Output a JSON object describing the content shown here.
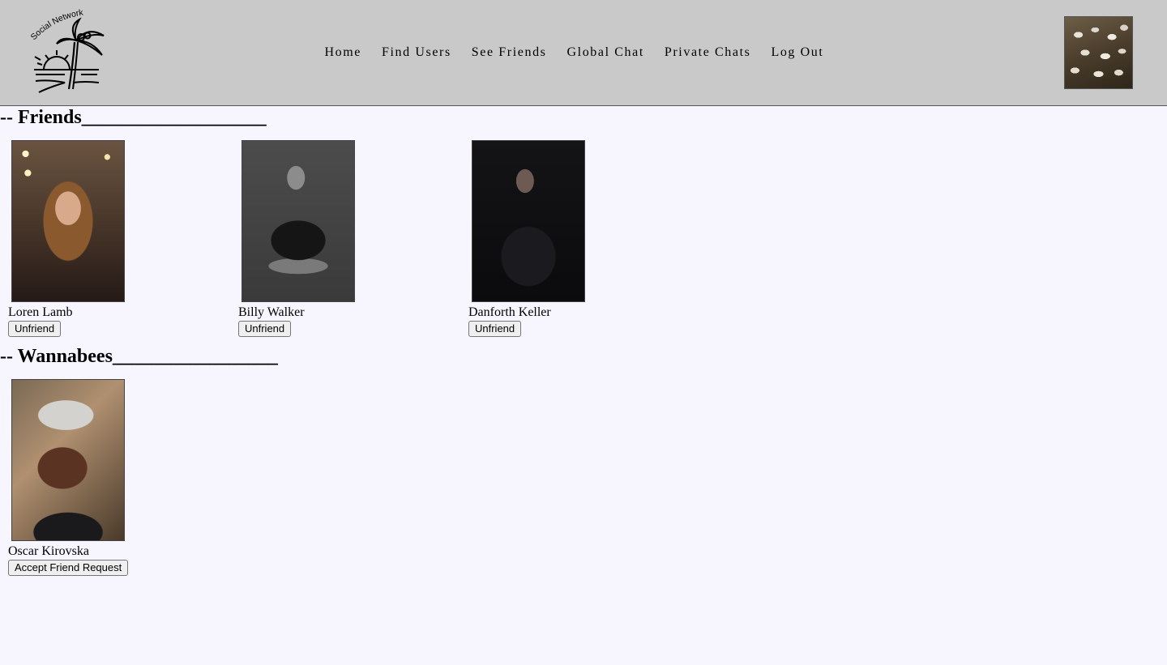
{
  "header": {
    "logo_text": "Social Network",
    "nav": [
      {
        "label": "Home"
      },
      {
        "label": "Find Users"
      },
      {
        "label": "See Friends"
      },
      {
        "label": "Global Chat"
      },
      {
        "label": "Private Chats"
      },
      {
        "label": "Log Out"
      }
    ],
    "avatar_icon": "user-avatar-mushrooms"
  },
  "friends_section": {
    "title": "-- Friends___________________",
    "items": [
      {
        "name": "Loren Lamb",
        "action": "Unfriend"
      },
      {
        "name": "Billy Walker",
        "action": "Unfriend"
      },
      {
        "name": "Danforth Keller",
        "action": "Unfriend"
      }
    ]
  },
  "wannabees_section": {
    "title": "-- Wannabees_________________",
    "items": [
      {
        "name": "Oscar Kirovska",
        "action": "Accept Friend Request"
      }
    ]
  },
  "colors": {
    "header_bg": "#c9c9c9",
    "page_bg": "#f7f6ff"
  }
}
